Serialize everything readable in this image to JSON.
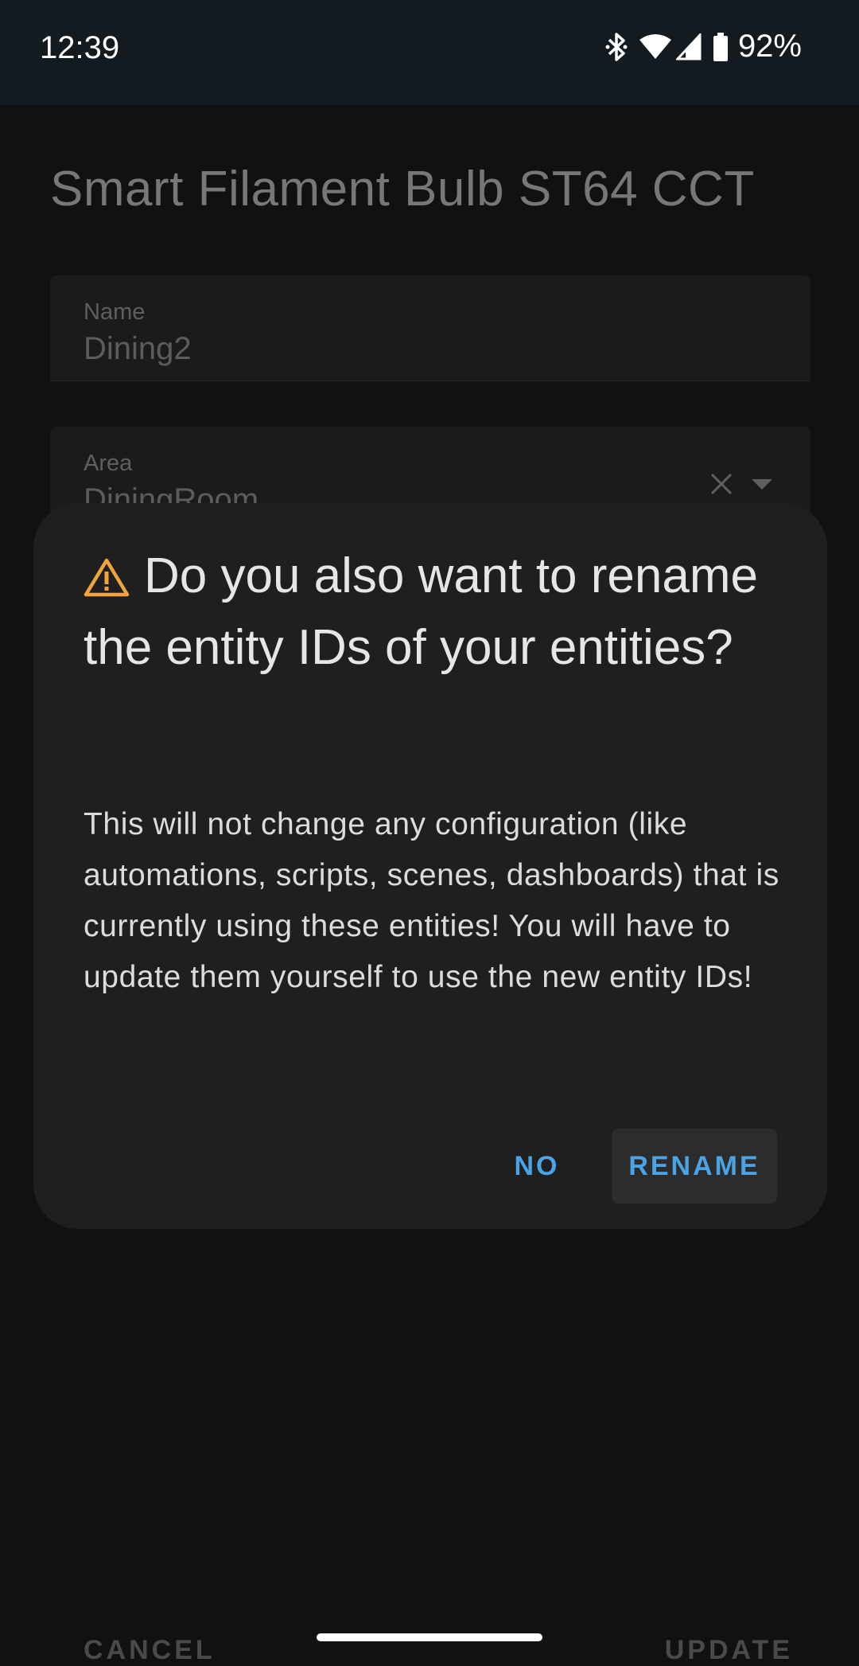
{
  "status_bar": {
    "time": "12:39",
    "battery": "92%",
    "icons": [
      "bluetooth-icon",
      "wifi-icon",
      "signal-icon",
      "battery-icon"
    ]
  },
  "page": {
    "title": "Smart Filament Bulb ST64 CCT",
    "name_field": {
      "label": "Name",
      "value": "Dining2"
    },
    "area_field": {
      "label": "Area",
      "value": "DiningRoom"
    },
    "cancel_label": "CANCEL",
    "update_label": "UPDATE"
  },
  "dialog": {
    "title": "Do you also want to rename the entity IDs of your entities?",
    "body": "This will not change any configuration (like automations, scripts, scenes, dashboards) that is currently using these entities! You will have to update them yourself to use the new entity IDs!",
    "no_label": "NO",
    "rename_label": "RENAME"
  },
  "colors": {
    "accent": "#4ba3e3",
    "warning": "#f0a43a",
    "dialog_bg": "#1f1f1f",
    "page_bg": "#111111",
    "status_bar_bg": "#141b20"
  }
}
